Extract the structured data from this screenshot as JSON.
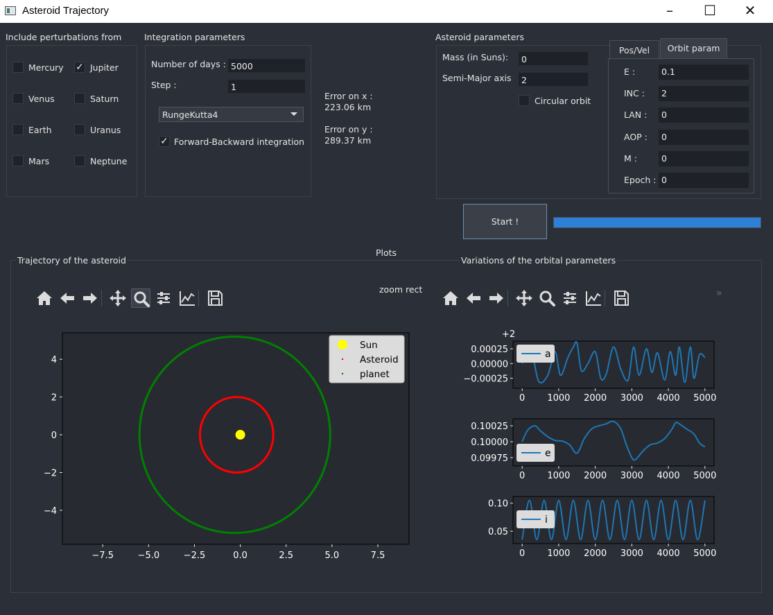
{
  "window": {
    "title": "Asteroid Trajectory"
  },
  "perturbations": {
    "title": "Include perturbations from",
    "planets": [
      {
        "label": "Mercury",
        "checked": false
      },
      {
        "label": "Jupiter",
        "checked": true
      },
      {
        "label": "Venus",
        "checked": false
      },
      {
        "label": "Saturn",
        "checked": false
      },
      {
        "label": "Earth",
        "checked": false
      },
      {
        "label": "Uranus",
        "checked": false
      },
      {
        "label": "Mars",
        "checked": false
      },
      {
        "label": "Neptune",
        "checked": false
      }
    ]
  },
  "integration": {
    "title": "Integration parameters",
    "days_label": "Number of days :",
    "days_value": "5000",
    "step_label": "Step :",
    "step_value": "1",
    "method": "RungeKutta4",
    "fb_label": "Forward-Backward integration",
    "fb_checked": true
  },
  "errors": {
    "x_label": "Error on x :",
    "x_value": "223.06 km",
    "y_label": "Error on y :",
    "y_value": "289.37 km"
  },
  "asteroid": {
    "title": "Asteroid parameters",
    "mass_label": "Mass (in Suns):",
    "mass_value": "0",
    "sma_label": "Semi-Major axis",
    "sma_value": "2",
    "circular_label": "Circular orbit",
    "circular_checked": false
  },
  "tabs": {
    "posvel": "Pos/Vel",
    "orbit": "Orbit param",
    "active": "orbit"
  },
  "orbit_params": [
    {
      "label": "E :",
      "value": "0.1"
    },
    {
      "label": "INC :",
      "value": "2"
    },
    {
      "label": "LAN :",
      "value": "0"
    },
    {
      "label": "AOP :",
      "value": "0"
    },
    {
      "label": "M :",
      "value": "0"
    },
    {
      "label": "Epoch :",
      "value": "0"
    }
  ],
  "start_label": "Start !",
  "progress": 1.0,
  "plots": {
    "title": "Plots",
    "trajectory_title": "Trajectory of the asteroid",
    "orbital_title": "Variations of the orbital parameters",
    "zoom_mode": "zoom rect"
  },
  "colors": {
    "sun": "#ffff00",
    "asteroid": "#ff0000",
    "planet": "#008000",
    "line": "#1f77b4",
    "progress": "#2d7fd8"
  },
  "chart_data": [
    {
      "type": "scatter",
      "title": "",
      "xlabel": "",
      "ylabel": "",
      "xlim": [
        -9.7,
        9.2
      ],
      "ylim": [
        -5.8,
        5.4
      ],
      "xticks": [
        "−7.5",
        "−5.0",
        "−2.5",
        "0.0",
        "2.5",
        "5.0",
        "7.5"
      ],
      "yticks": [
        "4",
        "2",
        "0",
        "−2",
        "−4"
      ],
      "legend": {
        "position": "top-right",
        "entries": [
          "Sun",
          "Asteroid",
          "planet"
        ]
      },
      "series": [
        {
          "name": "Sun",
          "x": [
            0
          ],
          "y": [
            0
          ]
        },
        {
          "name": "Asteroid",
          "shape": "circle",
          "center": [
            -0.2,
            0
          ],
          "radius": 2.0
        },
        {
          "name": "planet",
          "shape": "circle",
          "center": [
            -0.3,
            0
          ],
          "radius": 5.2
        }
      ]
    },
    {
      "type": "line",
      "name": "a",
      "offset_label": "+2",
      "xlim": [
        -250,
        5250
      ],
      "ylim": [
        -0.00042,
        0.00038
      ],
      "xticks": [
        "0",
        "1000",
        "2000",
        "3000",
        "4000",
        "5000"
      ],
      "yticks": [
        "0.00025",
        "0.00000",
        "−0.00025"
      ],
      "x": [
        0,
        100,
        250,
        450,
        700,
        900,
        1050,
        1250,
        1400,
        1500,
        1620,
        1800,
        2000,
        2150,
        2300,
        2500,
        2700,
        2900,
        3050,
        3200,
        3400,
        3550,
        3700,
        3900,
        4050,
        4200,
        4300,
        4450,
        4600,
        4700,
        4850,
        5000
      ],
      "y": [
        0.0,
        0.00015,
        0.00025,
        -0.0003,
        -0.0002,
        0.0002,
        -0.0002,
        0.0001,
        0.00028,
        0.00035,
        -0.00012,
        0.0,
        0.0002,
        -0.00025,
        -0.00018,
        0.00028,
        -0.0001,
        -0.00028,
        0.00028,
        -0.0002,
        0.00025,
        -0.00015,
        0.00018,
        -0.00028,
        0.0002,
        -0.0002,
        0.00028,
        -0.00032,
        0.00028,
        -0.00025,
        0.00015,
        0.0001
      ]
    },
    {
      "type": "line",
      "name": "e",
      "xlim": [
        -250,
        5250
      ],
      "ylim": [
        0.09962,
        0.10036
      ],
      "xticks": [
        "0",
        "1000",
        "2000",
        "3000",
        "4000",
        "5000"
      ],
      "yticks": [
        "0.10025",
        "0.10000",
        "0.09975"
      ],
      "x": [
        0,
        150,
        350,
        500,
        700,
        900,
        1100,
        1300,
        1500,
        1700,
        1900,
        2100,
        2300,
        2500,
        2700,
        2850,
        3000,
        3100,
        3300,
        3500,
        3700,
        3900,
        4100,
        4200,
        4300,
        4500,
        4700,
        4850,
        5000
      ],
      "y": [
        0.1,
        0.10018,
        0.10025,
        0.10017,
        0.10008,
        0.10002,
        0.10001,
        0.09995,
        0.09982,
        0.10005,
        0.1002,
        0.10025,
        0.10028,
        0.10032,
        0.1002,
        0.09995,
        0.09975,
        0.09972,
        0.09985,
        0.09995,
        0.09998,
        0.10005,
        0.1002,
        0.1003,
        0.10028,
        0.1002,
        0.10012,
        0.09998,
        0.09992
      ]
    },
    {
      "type": "line",
      "name": "i",
      "xlim": [
        -250,
        5250
      ],
      "ylim": [
        0.028,
        0.112
      ],
      "xticks": [
        "0",
        "1000",
        "2000",
        "3000",
        "4000",
        "5000"
      ],
      "yticks": [
        "0.10",
        "0.05"
      ],
      "x": [
        0,
        200,
        400,
        600,
        800,
        1000,
        1200,
        1400,
        1600,
        1800,
        2000,
        2200,
        2400,
        2600,
        2800,
        3000,
        3200,
        3400,
        3600,
        3800,
        4000,
        4200,
        4400,
        4600,
        4800,
        5000
      ],
      "y": [
        0.035,
        0.105,
        0.035,
        0.105,
        0.035,
        0.105,
        0.035,
        0.105,
        0.035,
        0.105,
        0.035,
        0.105,
        0.035,
        0.105,
        0.035,
        0.105,
        0.035,
        0.105,
        0.035,
        0.105,
        0.035,
        0.105,
        0.035,
        0.105,
        0.035,
        0.105
      ]
    }
  ]
}
